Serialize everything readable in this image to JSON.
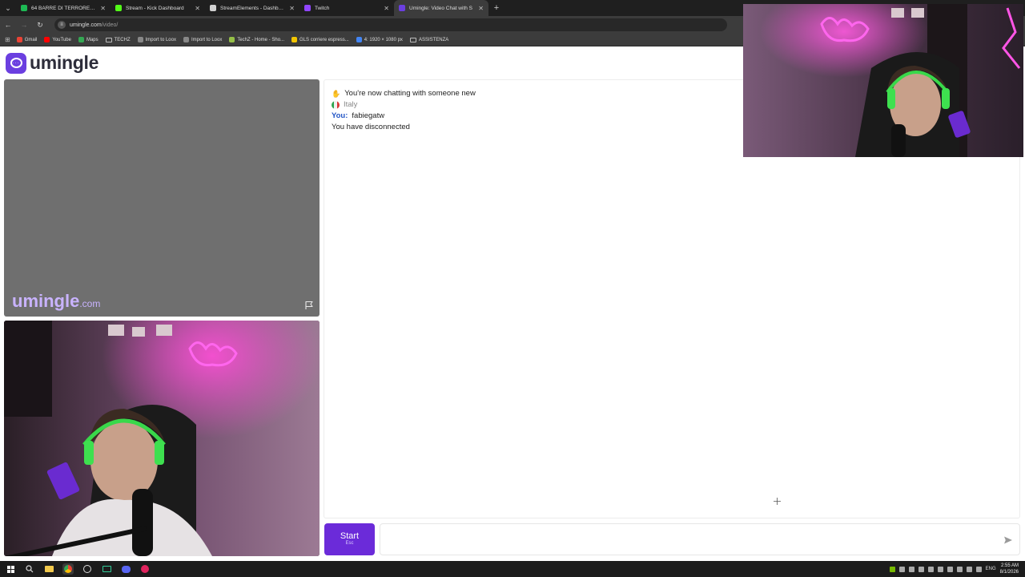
{
  "browser": {
    "tabs": [
      {
        "label": "64 BARRE DI TERRORE (Re",
        "color": "#1db954",
        "active": false
      },
      {
        "label": "Stream - Kick Dashboard",
        "color": "#53fc18",
        "active": false
      },
      {
        "label": "StreamElements - Dashboard",
        "color": "#d0d0d0",
        "active": false
      },
      {
        "label": "Twitch",
        "color": "#9146ff",
        "active": false
      },
      {
        "label": "Umingle: Video Chat with S",
        "color": "#6b3fe0",
        "active": true
      }
    ],
    "url_domain": "umingle.com",
    "url_path": "/video/",
    "bookmarks": [
      {
        "label": "Gmail",
        "icon": "gmail-icon",
        "color": "#ea4335"
      },
      {
        "label": "YouTube",
        "icon": "youtube-icon",
        "color": "#ff0000"
      },
      {
        "label": "Maps",
        "icon": "maps-icon",
        "color": "#34a853"
      },
      {
        "label": "TECHZ",
        "icon": "folder-icon",
        "color": ""
      },
      {
        "label": "Import to Loox",
        "icon": "globe-icon",
        "color": "#888888"
      },
      {
        "label": "Import to Loox",
        "icon": "globe-icon",
        "color": "#888888"
      },
      {
        "label": "TechZ - Home - Sho...",
        "icon": "shopify-icon",
        "color": "#95bf47"
      },
      {
        "label": "GLS corriere espress...",
        "icon": "gls-icon",
        "color": "#f2c500"
      },
      {
        "label": "4: 1920 × 1080 px",
        "icon": "image-icon",
        "color": "#4285f4"
      },
      {
        "label": "ASSISTENZA",
        "icon": "folder-icon",
        "color": ""
      }
    ]
  },
  "site": {
    "logo_text": "umingle",
    "watermark": "umingle",
    "watermark_suffix": ".com",
    "accent": "#6b2bd9"
  },
  "chat": {
    "lines": {
      "intro": "You're now chatting with someone new",
      "country": "Italy",
      "you_label": "You:",
      "you_message": "fabiegatw",
      "status": "You have disconnected"
    },
    "input_value": "",
    "start_label": "Start",
    "start_hint": "Esc"
  },
  "taskbar": {
    "language": "ENG",
    "time": "2:55 AM",
    "date": "8/1/2026"
  }
}
